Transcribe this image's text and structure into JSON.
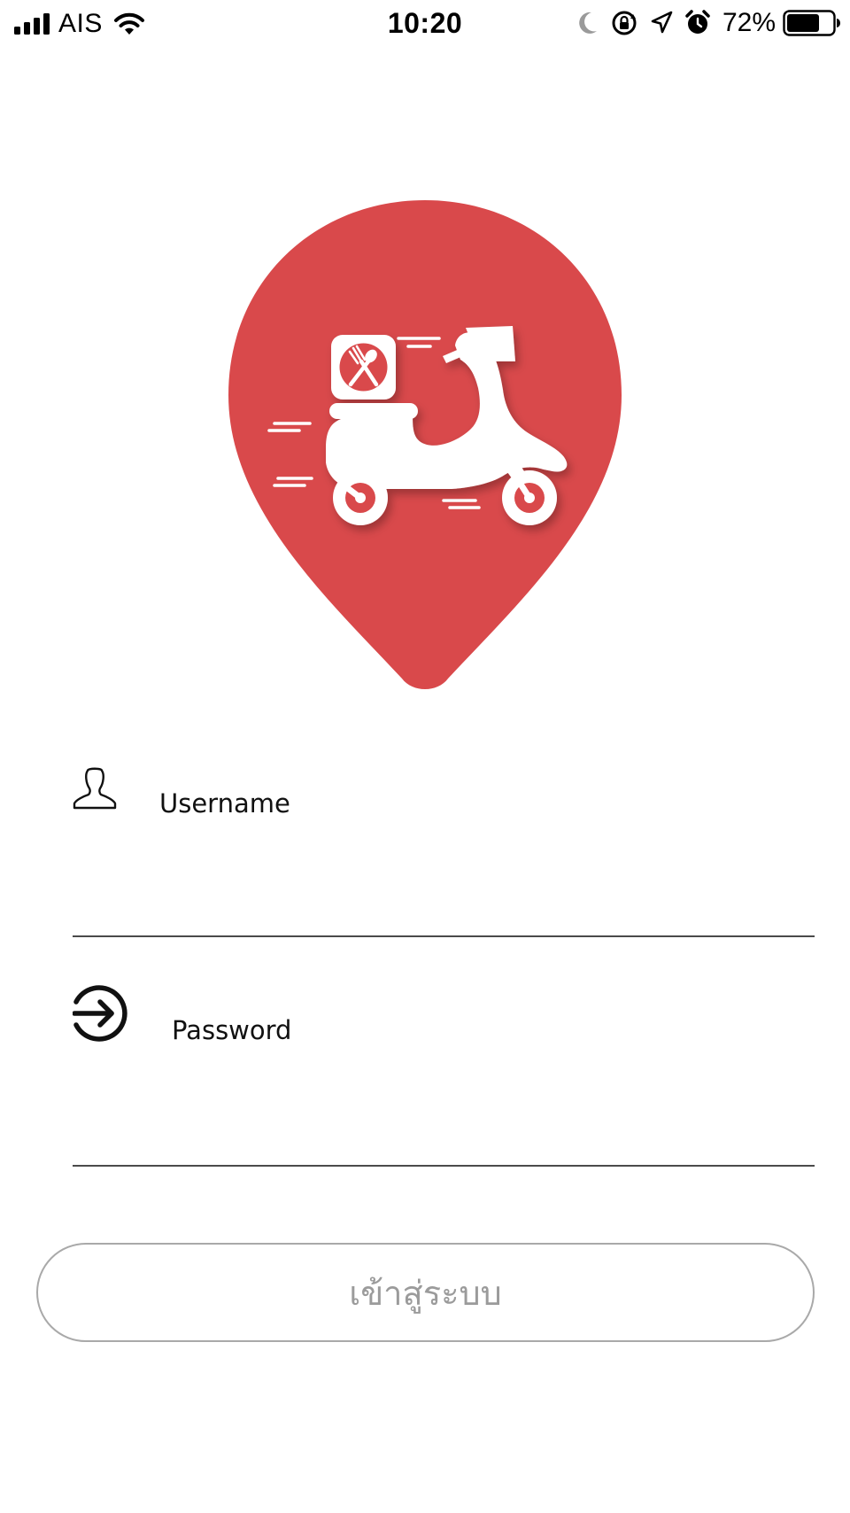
{
  "status_bar": {
    "carrier": "AIS",
    "time": "10:20",
    "battery_percent": "72%",
    "battery_level": 0.72,
    "icons": [
      "signal-icon",
      "wifi-icon",
      "moon-icon",
      "rotation-lock-icon",
      "location-arrow-icon",
      "alarm-icon",
      "battery-icon"
    ]
  },
  "logo": {
    "icon": "scooter-delivery-pin-logo",
    "color": "#d9494b"
  },
  "form": {
    "username": {
      "label": "Username",
      "value": "",
      "icon": "user-icon"
    },
    "password": {
      "label": "Password",
      "value": "",
      "icon": "login-arrow-icon"
    },
    "login_button": {
      "label": "เข้าสู่ระบบ"
    }
  }
}
